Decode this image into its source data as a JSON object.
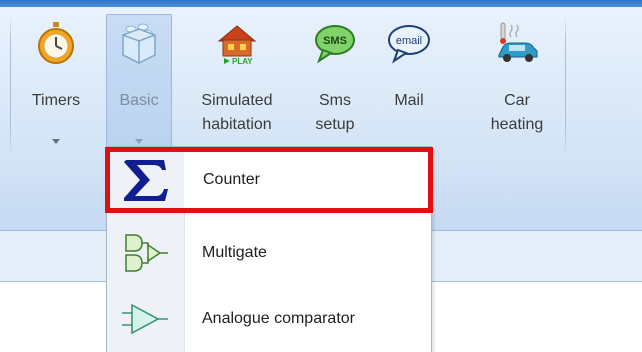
{
  "ribbon": {
    "buttons": [
      {
        "key": "timers",
        "label": "Timers",
        "icon": "stopwatch-icon",
        "dropdown": true,
        "active": false
      },
      {
        "key": "basic",
        "label": "Basic",
        "icon": "lego-brick-icon",
        "dropdown": true,
        "active": true
      },
      {
        "key": "simulated",
        "label": "Simulated habitation",
        "line1": "Simulated",
        "line2": "habitation",
        "icon": "house-play-icon",
        "icon_caption": "PLAY",
        "dropdown": false,
        "active": false
      },
      {
        "key": "sms",
        "label": "Sms setup",
        "line1": "Sms",
        "line2": "setup",
        "icon": "sms-bubble-icon",
        "icon_caption": "SMS",
        "dropdown": false,
        "active": false
      },
      {
        "key": "mail",
        "label": "Mail",
        "icon": "email-bubble-icon",
        "icon_caption": "email",
        "dropdown": false,
        "active": false
      },
      {
        "key": "car",
        "label": "Car heating",
        "line1": "Car",
        "line2": "heating",
        "icon": "car-heating-icon",
        "dropdown": false,
        "active": false
      }
    ]
  },
  "dropdown_menu": {
    "items": [
      {
        "label": "Counter",
        "icon": "sigma-icon",
        "highlighted": true
      },
      {
        "label": "Multigate",
        "icon": "logic-gates-icon",
        "highlighted": false
      },
      {
        "label": "Analogue comparator",
        "icon": "comparator-icon",
        "highlighted": false
      }
    ]
  },
  "colors": {
    "highlight_border": "#e01010",
    "sigma": "#0f1f8f",
    "ribbon_bg": "#dbe9f8",
    "title_bar": "#2f72c8"
  }
}
